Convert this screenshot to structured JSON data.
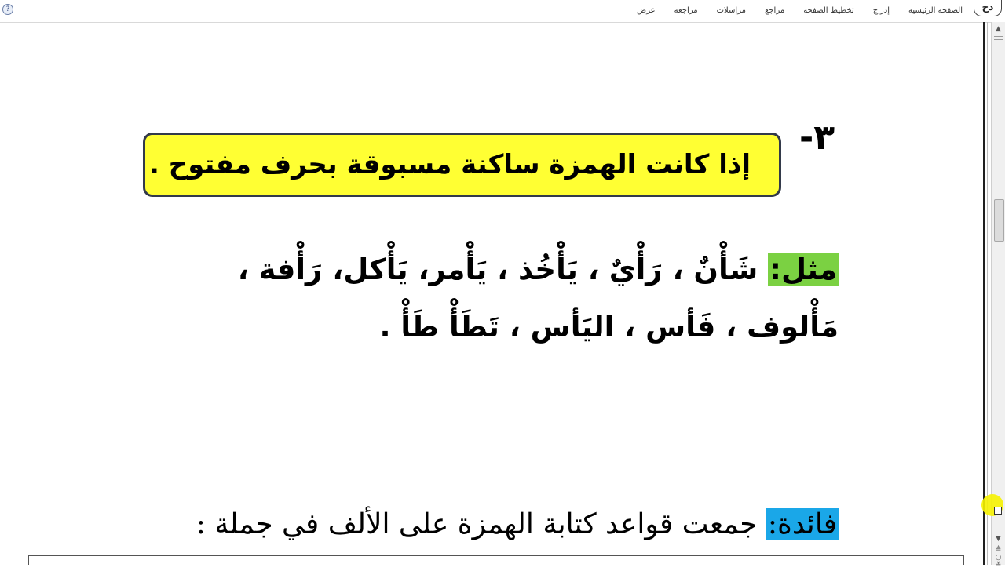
{
  "ribbon": {
    "tabs": [
      "الصفحة الرئيسية",
      "إدراج",
      "تخطيط الصفحة",
      "مراجع",
      "مراسلات",
      "مراجعة",
      "عرض"
    ],
    "help_icon": "help-icon",
    "logo_text": "ذخ"
  },
  "content": {
    "item_number": "٣-",
    "rule_text": "إذا كانت الهمزة ساكنة مسبوقة بحرف مفتوح .",
    "example_label": "مثل:",
    "example_line1": " شَأْنٌ ، رَأْيٌ ، يَأْخُذ ، يَأْمر، يَأْكل، رَأْفة ،",
    "example_line2": "مَأْلوف ، فَأس ، اليَأس ، تَطَأْ طَأْ .",
    "benefit_label": "فائدة:",
    "benefit_text": " جمعت قواعد كتابة الهمزة على الألف في جملة :"
  },
  "colors": {
    "rule_box_bg": "#ffff33",
    "example_label_bg": "#7bd142",
    "benefit_label_bg": "#1aa7e8",
    "highlight_red": "#e00000"
  }
}
